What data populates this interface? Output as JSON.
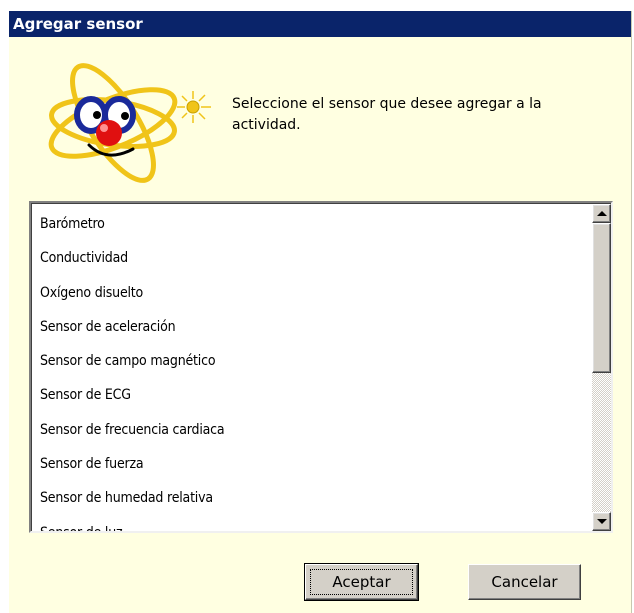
{
  "dialog": {
    "title": "Agregar sensor",
    "prompt": "Seleccione el sensor que desee agregar a la actividad."
  },
  "sensor_list": {
    "items": [
      "Barómetro",
      "Conductividad",
      "Oxígeno disuelto",
      "Sensor de aceleración",
      "Sensor de campo magnético",
      "Sensor de ECG",
      "Sensor de frecuencia cardiaca",
      "Sensor de fuerza",
      "Sensor de humedad relativa",
      "Sensor de luz"
    ]
  },
  "buttons": {
    "ok_label": "Aceptar",
    "cancel_label": "Cancelar"
  },
  "colors": {
    "titlebar": "#0a246a",
    "dialog_background": "#ffffe1",
    "button_face": "#d4d0c8"
  },
  "icons": {
    "logo": "atom-mascot-icon",
    "scroll_up": "arrow-up-icon",
    "scroll_down": "arrow-down-icon"
  }
}
